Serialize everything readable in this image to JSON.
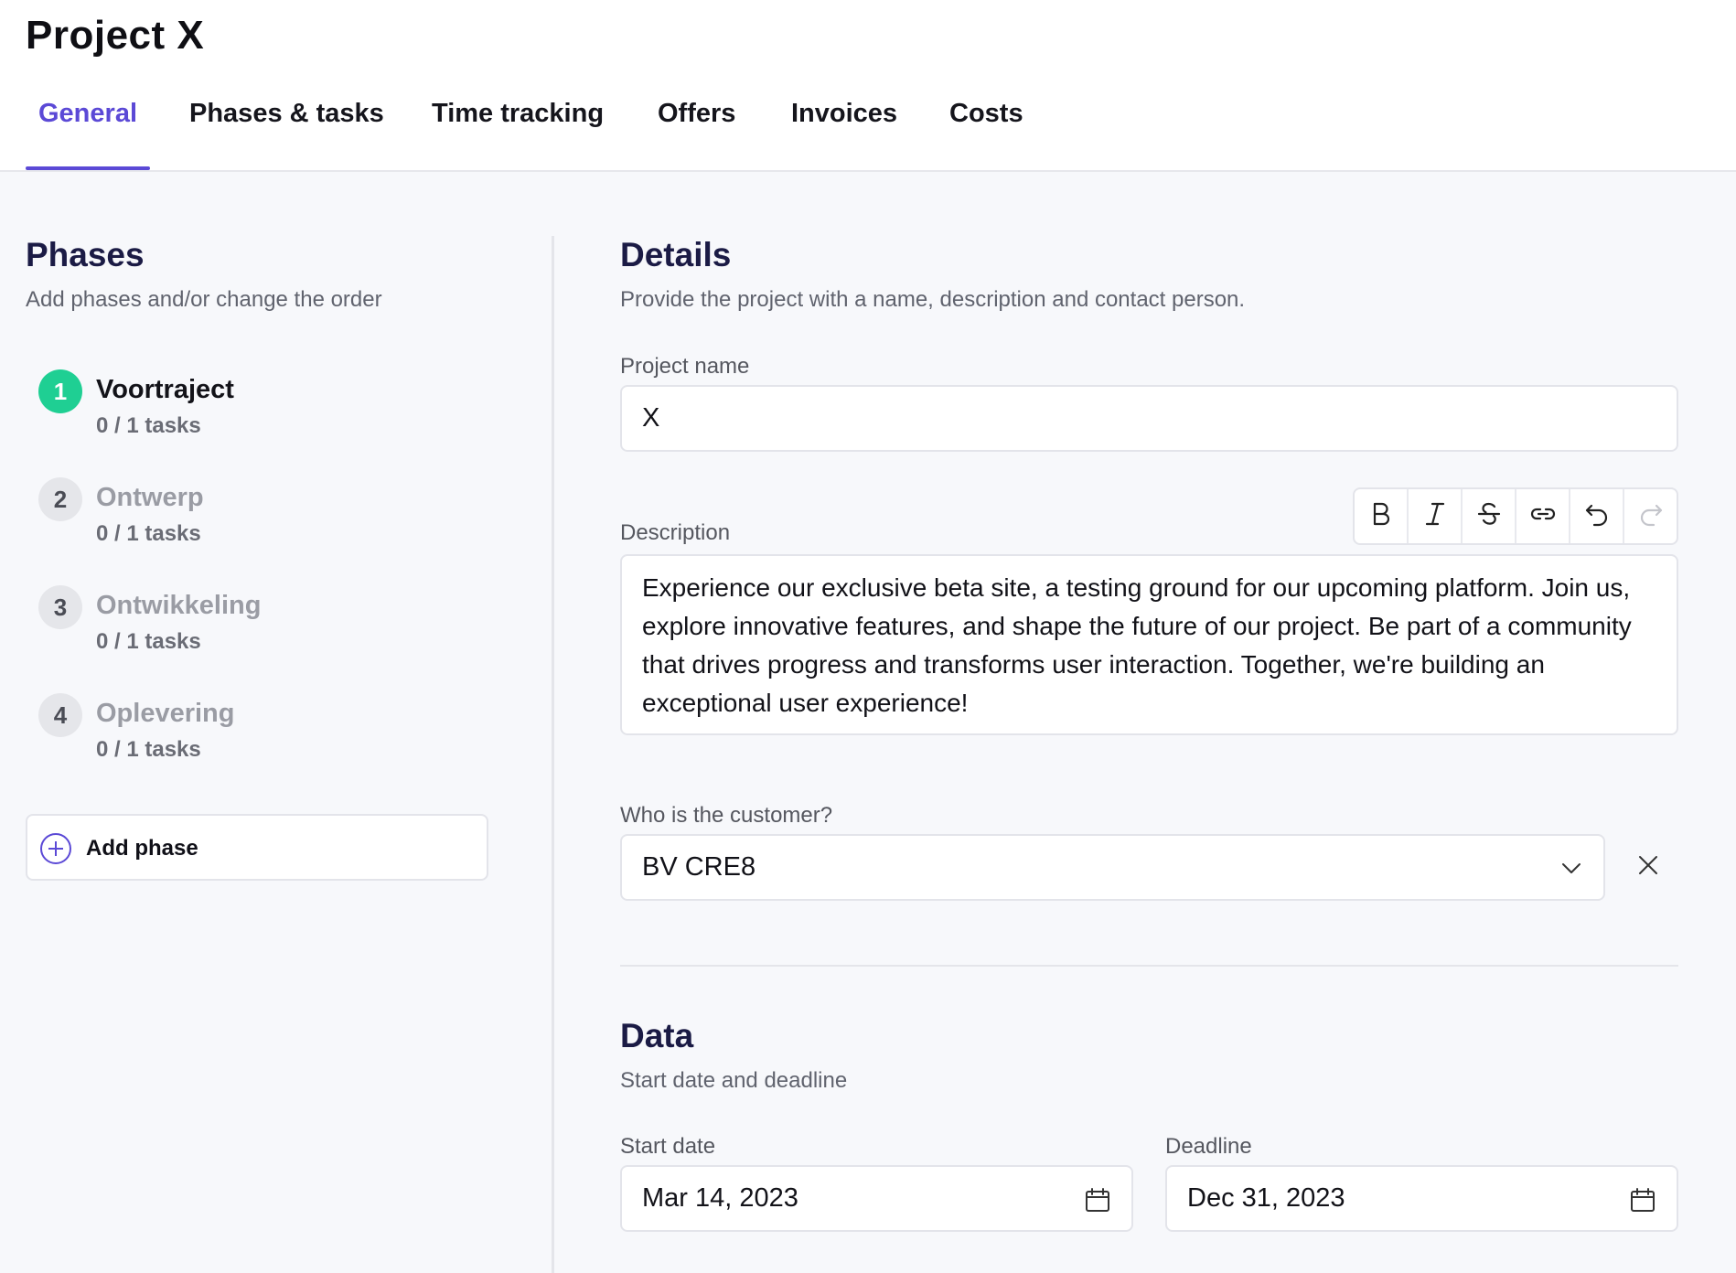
{
  "header": {
    "title": "Project  X",
    "tabs": [
      {
        "label": "General",
        "active": true
      },
      {
        "label": "Phases & tasks"
      },
      {
        "label": "Time tracking"
      },
      {
        "label": "Offers"
      },
      {
        "label": "Invoices"
      },
      {
        "label": "Costs"
      }
    ]
  },
  "phases_panel": {
    "title": "Phases",
    "subtitle": "Add phases and/or change the order",
    "phases": [
      {
        "number": "1",
        "name": "Voortraject",
        "tasks": "0 / 1 tasks",
        "active": true
      },
      {
        "number": "2",
        "name": "Ontwerp",
        "tasks": "0 / 1 tasks"
      },
      {
        "number": "3",
        "name": "Ontwikkeling",
        "tasks": "0 / 1 tasks"
      },
      {
        "number": "4",
        "name": "Oplevering",
        "tasks": "0 / 1 tasks"
      }
    ],
    "add_phase_label": "Add phase"
  },
  "details": {
    "title": "Details",
    "subtitle": "Provide the project with a name, description and contact person.",
    "project_name_label": "Project name",
    "project_name_value": "X",
    "description_label": "Description",
    "description_value": "Experience our exclusive beta site, a testing ground for our upcoming platform. Join us, explore innovative features, and shape the future of our project. Be part of a community that drives progress and transforms user interaction. Together, we're building an exceptional user experience!",
    "toolbar": [
      "bold-icon",
      "italic-icon",
      "strikethrough-icon",
      "link-icon",
      "undo-icon",
      "redo-icon"
    ],
    "customer_label": "Who is the customer?",
    "customer_value": "BV CRE8"
  },
  "data_section": {
    "title": "Data",
    "subtitle": "Start date and deadline",
    "start_date_label": "Start date",
    "start_date_value": "Mar 14, 2023",
    "deadline_label": "Deadline",
    "deadline_value": "Dec 31, 2023"
  },
  "colors": {
    "accent": "#5b49d6",
    "active_phase": "#1fcf93",
    "heading": "#1b1b45"
  }
}
